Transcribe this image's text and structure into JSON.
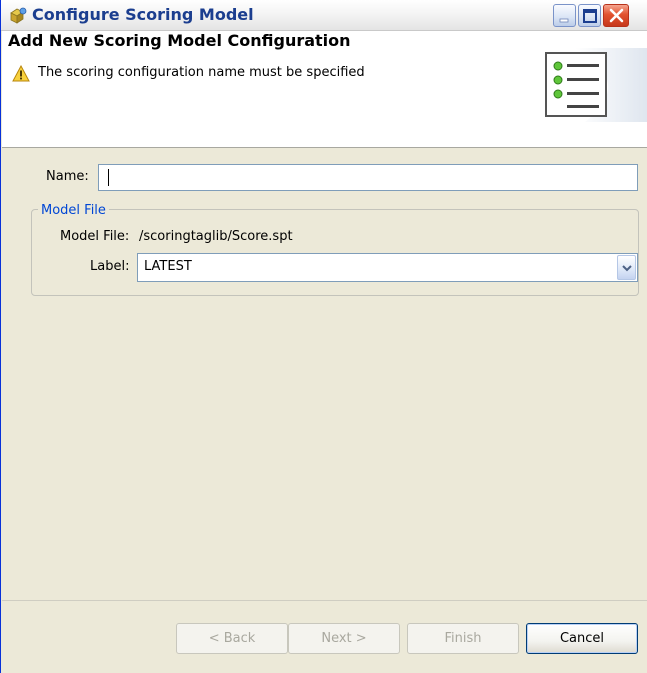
{
  "window": {
    "title": "Configure Scoring Model",
    "controls": {
      "minimize_icon": "minimize-icon",
      "maximize_icon": "maximize-icon",
      "close_icon": "close-icon"
    }
  },
  "header": {
    "title": "Add New Scoring Model Configuration",
    "message": "The scoring configuration name must be specified",
    "message_icon": "warning-icon",
    "banner_icon": "list-checklist-icon"
  },
  "form": {
    "name_label": "Name:",
    "name_value": "",
    "group_title": "Model File",
    "model_file_label": "Model File:",
    "model_file_value": "/scoringtaglib/Score.spt",
    "label_label": "Label:",
    "label_selected": "LATEST"
  },
  "buttons": {
    "back": "< Back",
    "next": "Next >",
    "finish": "Finish",
    "cancel": "Cancel"
  },
  "colors": {
    "title_text": "#1b3e8f",
    "group_title": "#0046d5",
    "dialog_background": "#ece9d8",
    "close_button": "#e2532f"
  }
}
